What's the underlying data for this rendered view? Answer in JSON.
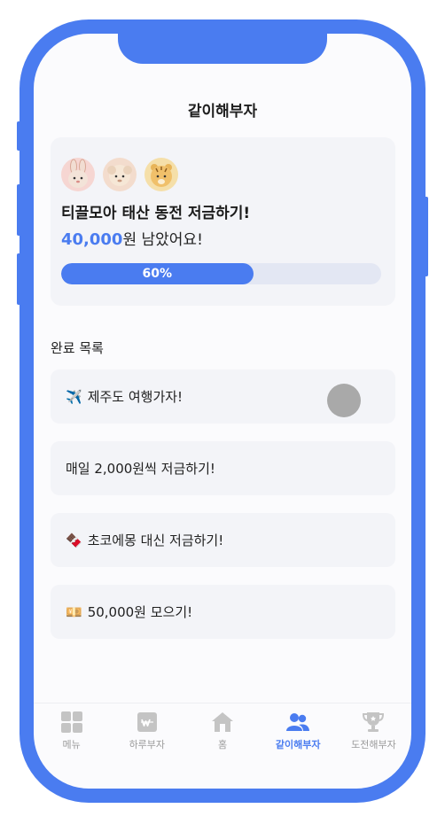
{
  "header": {
    "title": "같이해부자"
  },
  "challenge": {
    "avatars": [
      "rabbit-avatar",
      "sheep-avatar",
      "tiger-avatar"
    ],
    "title": "티끌모아 태산 동전 저금하기!",
    "remaining_amount": "40,000",
    "remaining_suffix": "원 남았어요!",
    "progress_label": "60%",
    "progress_fraction": 0.6
  },
  "completed": {
    "label": "완료 목록",
    "items": [
      {
        "icon": "✈️",
        "icon_name": "airplane-icon",
        "text": "제주도 여행가자!"
      },
      {
        "icon": "",
        "icon_name": "",
        "text": "매일 2,000원씩 저금하기!"
      },
      {
        "icon": "🍫",
        "icon_name": "chocolate-icon",
        "text": "초코에몽 대신 저금하기!"
      },
      {
        "icon": "💴",
        "icon_name": "money-icon",
        "text": "50,000원 모으기!"
      }
    ]
  },
  "tabbar": {
    "tabs": [
      {
        "label": "메뉴",
        "icon": "grid-menu-icon"
      },
      {
        "label": "하루부자",
        "icon": "wallet-icon"
      },
      {
        "label": "홈",
        "icon": "home-icon"
      },
      {
        "label": "같이해부자",
        "icon": "people-icon",
        "active": true
      },
      {
        "label": "도전해부자",
        "icon": "trophy-icon"
      }
    ]
  },
  "colors": {
    "accent": "#4a7cf0",
    "inactive": "#c4c4c4",
    "card": "#f3f4f8"
  }
}
